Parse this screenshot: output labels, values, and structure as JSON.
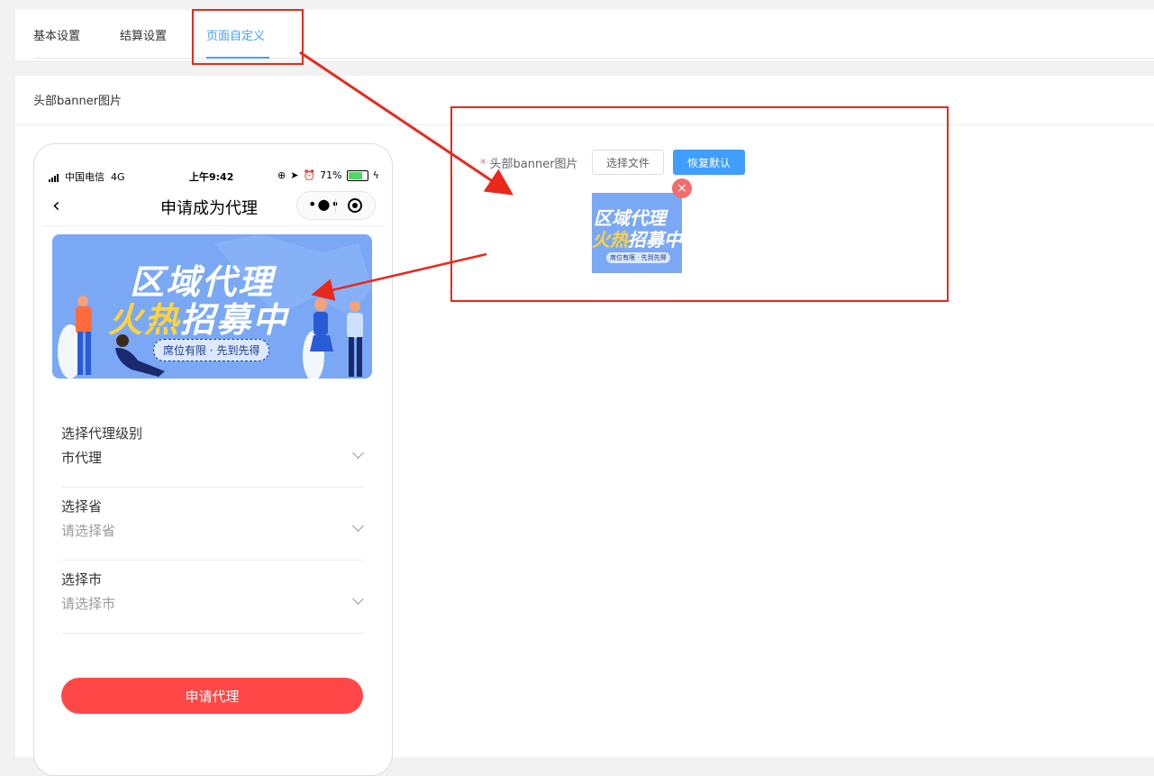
{
  "tabs": [
    {
      "label": "基本设置"
    },
    {
      "label": "结算设置"
    },
    {
      "label": "页面自定义"
    }
  ],
  "panel": {
    "title": "头部banner图片"
  },
  "phone": {
    "status": {
      "carrier": "中国电信",
      "network": "4G",
      "time": "上午9:42",
      "battery": "71%"
    },
    "nav": {
      "back": "‹",
      "title": "申请成为代理"
    },
    "banner": {
      "line1": "区域代理",
      "line2_hot": "火热",
      "line2_rest": "招募中",
      "sub": "席位有限 · 先到先得"
    },
    "fields": [
      {
        "label": "选择代理级别",
        "value": "市代理",
        "placeholder": false
      },
      {
        "label": "选择省",
        "value": "请选择省",
        "placeholder": true
      },
      {
        "label": "选择市",
        "value": "请选择市",
        "placeholder": true
      }
    ],
    "apply_button": "申请代理"
  },
  "form": {
    "label": "头部banner图片",
    "required_mark": "*",
    "choose_file": "选择文件",
    "restore_default": "恢复默认",
    "thumb": {
      "line1": "区域代理",
      "line2_hot": "火热",
      "line2_rest": "招募中",
      "sub": "席位有限 · 先到先得"
    },
    "remove_icon": "×"
  },
  "colors": {
    "accent": "#409eff",
    "annotation": "#e8291c",
    "apply": "#ff4747",
    "banner": "#7aa8f5"
  }
}
